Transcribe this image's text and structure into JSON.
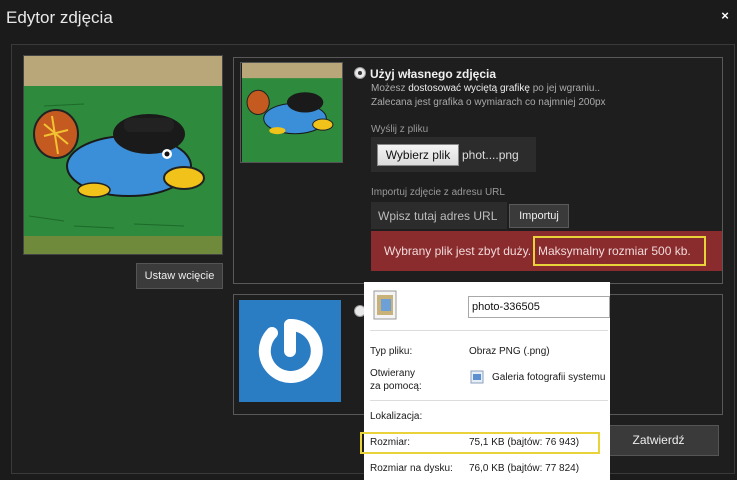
{
  "window": {
    "title": "Edytor zdjęcia",
    "close_label": "×"
  },
  "left": {
    "set_crop_label": "Ustaw wcięcie"
  },
  "own_photo": {
    "title": "Użyj własnego zdjęcia",
    "desc1_pre": "Możesz ",
    "desc1_hl": "dostosować wyciętą grafikę",
    "desc1_post": " po jej wgraniu..",
    "desc2": "Zalecana jest grafika o wymiarach co najmniej 200px",
    "send_label": "Wyślij z pliku",
    "file_button": "Wybierz plik",
    "file_name": "phot....png",
    "import_label": "Importuj zdjęcie z adresu URL",
    "url_placeholder": "Wpisz tutaj adres URL",
    "import_button": "Importuj",
    "error_text": "Wybrany plik jest zbyt duży.",
    "error_size": "Maksymalny rozmiar 500 kb."
  },
  "confirm_label": "Zatwierdź",
  "properties": {
    "file_name": "photo-336505",
    "type_label": "Typ pliku:",
    "type_value": "Obraz PNG (.png)",
    "opens_label_1": "Otwierany",
    "opens_label_2": "za pomocą:",
    "opens_value": "Galeria fotografii systemu",
    "location_label": "Lokalizacja:",
    "size_label": "Rozmiar:",
    "size_value": "75,1 KB (bajtów: 76 943)",
    "disk_size_label": "Rozmiar na dysku:",
    "disk_size_value": "76,0 KB (bajtów: 77 824)"
  },
  "colors": {
    "error_bg": "#8a2b2d",
    "highlight": "#e8d33a",
    "gravatar_blue": "#2a7cc3"
  }
}
